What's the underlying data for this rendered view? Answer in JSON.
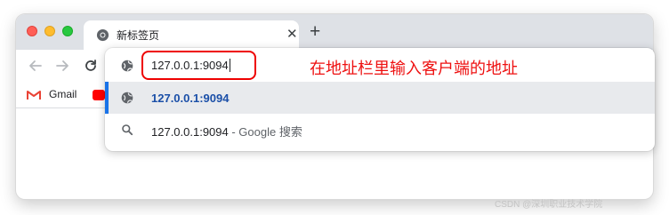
{
  "browser": {
    "tab": {
      "title": "新标签页",
      "close_symbol": "✕",
      "favicon": "chrome-icon"
    },
    "new_tab_symbol": "+",
    "nav": {
      "back_icon": "back-arrow-icon",
      "forward_icon": "forward-arrow-icon",
      "reload_icon": "reload-icon"
    },
    "bookmarks": [
      {
        "label": "Gmail",
        "icon": "gmail-icon"
      },
      {
        "label": "",
        "icon": "youtube-icon"
      }
    ]
  },
  "omnibox": {
    "input_value": "127.0.0.1:9094",
    "suggestions": [
      {
        "icon": "globe-icon",
        "text": "127.0.0.1:9094",
        "suffix": "",
        "selected": true
      },
      {
        "icon": "search-icon",
        "text": "127.0.0.1:9094",
        "suffix": " - Google 搜索",
        "selected": false
      }
    ]
  },
  "annotation": {
    "text": "在地址栏里输入客户端的地址",
    "color": "#ee1111"
  },
  "watermark": "CSDN @深圳职业技术学院",
  "colors": {
    "accent": "#1a73e8",
    "selected_row": "#e8eaed",
    "link_text": "#1a4fa8",
    "tabstrip": "#dee1e6"
  }
}
